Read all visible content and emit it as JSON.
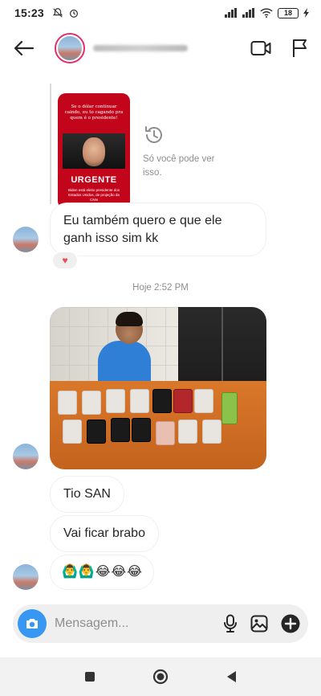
{
  "status": {
    "time": "15:23",
    "battery": "18"
  },
  "header": {
    "back_icon": "arrow-left-icon",
    "video_icon": "video-call-icon",
    "report_icon": "flag-icon"
  },
  "story_reply": {
    "headline": "Se o dólar continuar caindo, eu to cagando pra quem é o presidente!",
    "banner": "URGENTE",
    "subtext": "Biden está eleito presidente dos Estados Unidos, de projeção da CNN",
    "visibility_note": "Só você pode ver isso."
  },
  "messages": [
    {
      "id": "m1",
      "text": "Eu também quero e que ele ganh isso sim kk",
      "reaction": "♥"
    },
    {
      "id": "m2",
      "text": "Tio SAN"
    },
    {
      "id": "m3",
      "text": "Vai ficar brabo"
    },
    {
      "id": "m4",
      "emojis": [
        "🙆‍♂️",
        "🙆‍♂️",
        "😂",
        "😂",
        "😂"
      ]
    }
  ],
  "timestamp": "Hoje 2:52 PM",
  "composer": {
    "placeholder": "Mensagem...",
    "camera_icon": "camera-icon",
    "mic_icon": "microphone-icon",
    "gallery_icon": "image-icon",
    "plus_icon": "add-icon"
  },
  "nav": {
    "back": "triangle-back-icon",
    "home": "circle-home-icon",
    "recents": "square-recents-icon"
  },
  "colors": {
    "accent": "#3897f0",
    "heart": "#ed4956",
    "story_red": "#c2051a"
  }
}
